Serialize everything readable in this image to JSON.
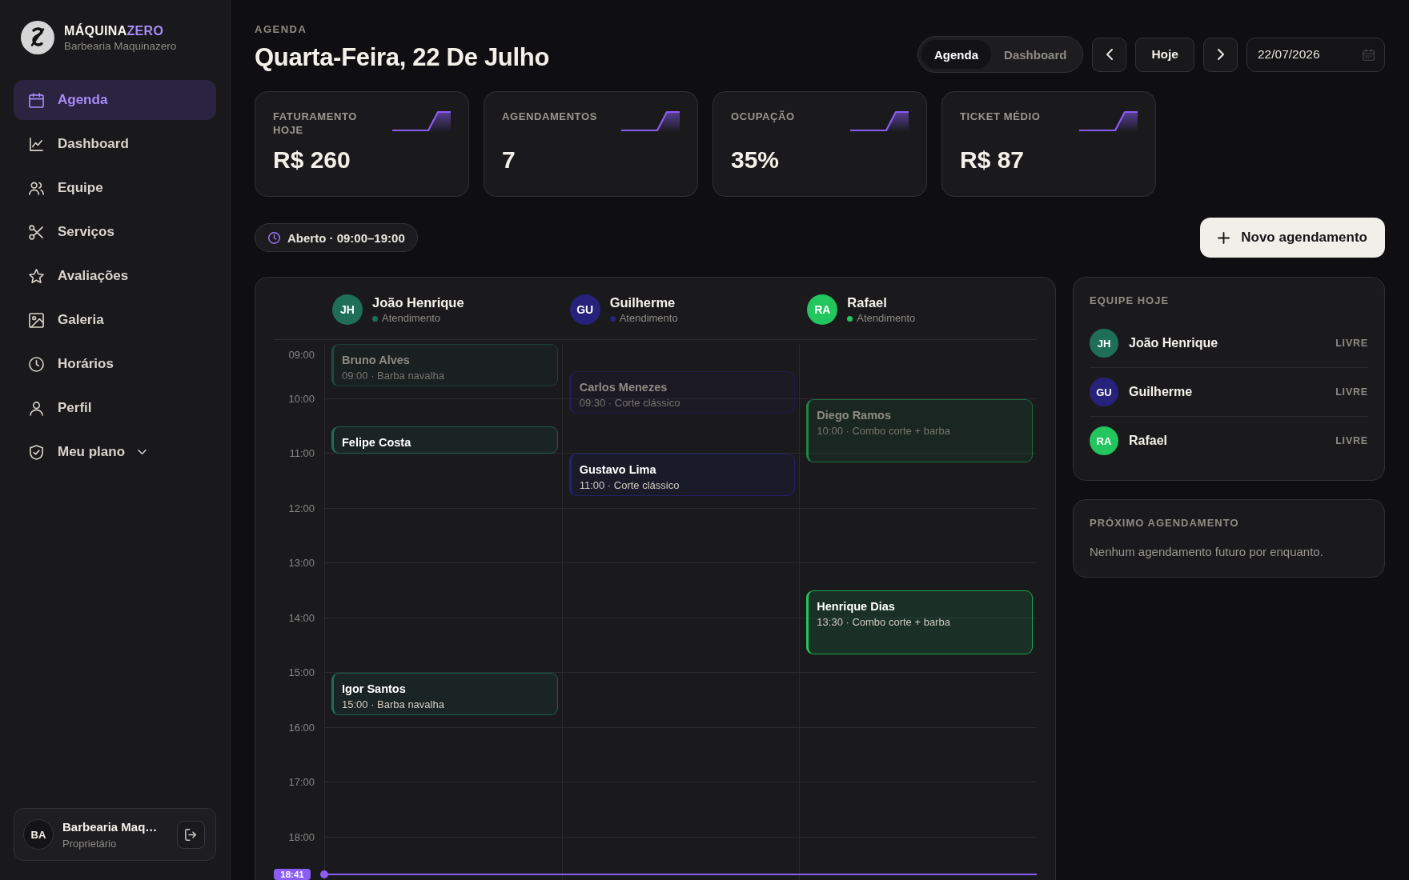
{
  "sidebar": {
    "brand": {
      "name": "MÁQUINA",
      "name_accent": "ZERO",
      "subtitle": "Barbearia Maquinazero"
    },
    "nav": [
      {
        "label": "Agenda",
        "kind": "link",
        "selected": true
      },
      {
        "label": "Dashboard",
        "kind": "link",
        "selected": false
      },
      {
        "label": "Equipe",
        "kind": "link",
        "selected": false
      },
      {
        "label": "Serviços",
        "kind": "link",
        "selected": false
      },
      {
        "label": "Avaliações",
        "kind": "link",
        "selected": false
      },
      {
        "label": "Galeria",
        "kind": "link",
        "selected": false
      },
      {
        "label": "Horários",
        "kind": "link",
        "selected": false
      },
      {
        "label": "Perfil",
        "kind": "link",
        "selected": false
      },
      {
        "label": "Meu plano",
        "kind": "menu",
        "selected": false
      }
    ],
    "account": {
      "initials": "BA",
      "name": "Barbearia Maq…",
      "role": "Proprietário"
    }
  },
  "header": {
    "eyebrow": "AGENDA",
    "title": "Quarta-Feira, 22 De Julho",
    "view_tabs": [
      {
        "label": "Agenda",
        "selected": true
      },
      {
        "label": "Dashboard",
        "selected": false
      }
    ],
    "today_button": "Hoje",
    "date_field": {
      "value": "22/07/2026"
    }
  },
  "stats": [
    {
      "label": "FATURAMENTO HOJE",
      "value": "R$ 260"
    },
    {
      "label": "AGENDAMENTOS",
      "value": "7"
    },
    {
      "label": "OCUPAÇÃO",
      "value": "35%"
    },
    {
      "label": "TICKET MÉDIO",
      "value": "R$ 87"
    }
  ],
  "toolbar": {
    "opening_hours": "Aberto · 09:00–19:00",
    "new_button": "Novo agendamento"
  },
  "calendar": {
    "hours": [
      "09:00",
      "10:00",
      "11:00",
      "12:00",
      "13:00",
      "14:00",
      "15:00",
      "16:00",
      "17:00",
      "18:00"
    ],
    "now": "18:41",
    "columns": [
      {
        "initials": "JH",
        "name": "João Henrique",
        "status": "Atendimento",
        "color": "#1f6f56",
        "events": [
          {
            "client": "Bruno Alves",
            "detail": "09:00 · Barba navalha",
            "dimmed": true
          },
          {
            "client": "Felipe Costa",
            "dimmed": false
          },
          {
            "client": "Igor Santos",
            "detail": "15:00 · Barba navalha",
            "dimmed": false
          }
        ]
      },
      {
        "initials": "GU",
        "name": "Guilherme",
        "status": "Atendimento",
        "color": "#26217a",
        "events": [
          {
            "client": "Carlos Menezes",
            "detail": "09:30 · Corte clássico",
            "dimmed": true
          },
          {
            "client": "Gustavo Lima",
            "detail": "11:00 · Corte clássico",
            "dimmed": false
          }
        ]
      },
      {
        "initials": "RA",
        "name": "Rafael",
        "status": "Atendimento",
        "color": "#22c55e",
        "events": [
          {
            "client": "Diego Ramos",
            "detail": "10:00 · Combo corte + barba",
            "dimmed": true
          },
          {
            "client": "Henrique Dias",
            "detail": "13:30 · Combo corte + barba",
            "dimmed": false
          }
        ]
      }
    ]
  },
  "team": {
    "title": "EQUIPE HOJE",
    "members": [
      {
        "initials": "JH",
        "name": "João Henrique",
        "status": "LIVRE",
        "color": "#1f6f56"
      },
      {
        "initials": "GU",
        "name": "Guilherme",
        "status": "LIVRE",
        "color": "#26217a"
      },
      {
        "initials": "RA",
        "name": "Rafael",
        "status": "LIVRE",
        "color": "#22c55e"
      }
    ]
  },
  "next_appointment": {
    "title": "PRÓXIMO AGENDAMENTO",
    "message": "Nenhum agendamento futuro por enquanto."
  }
}
